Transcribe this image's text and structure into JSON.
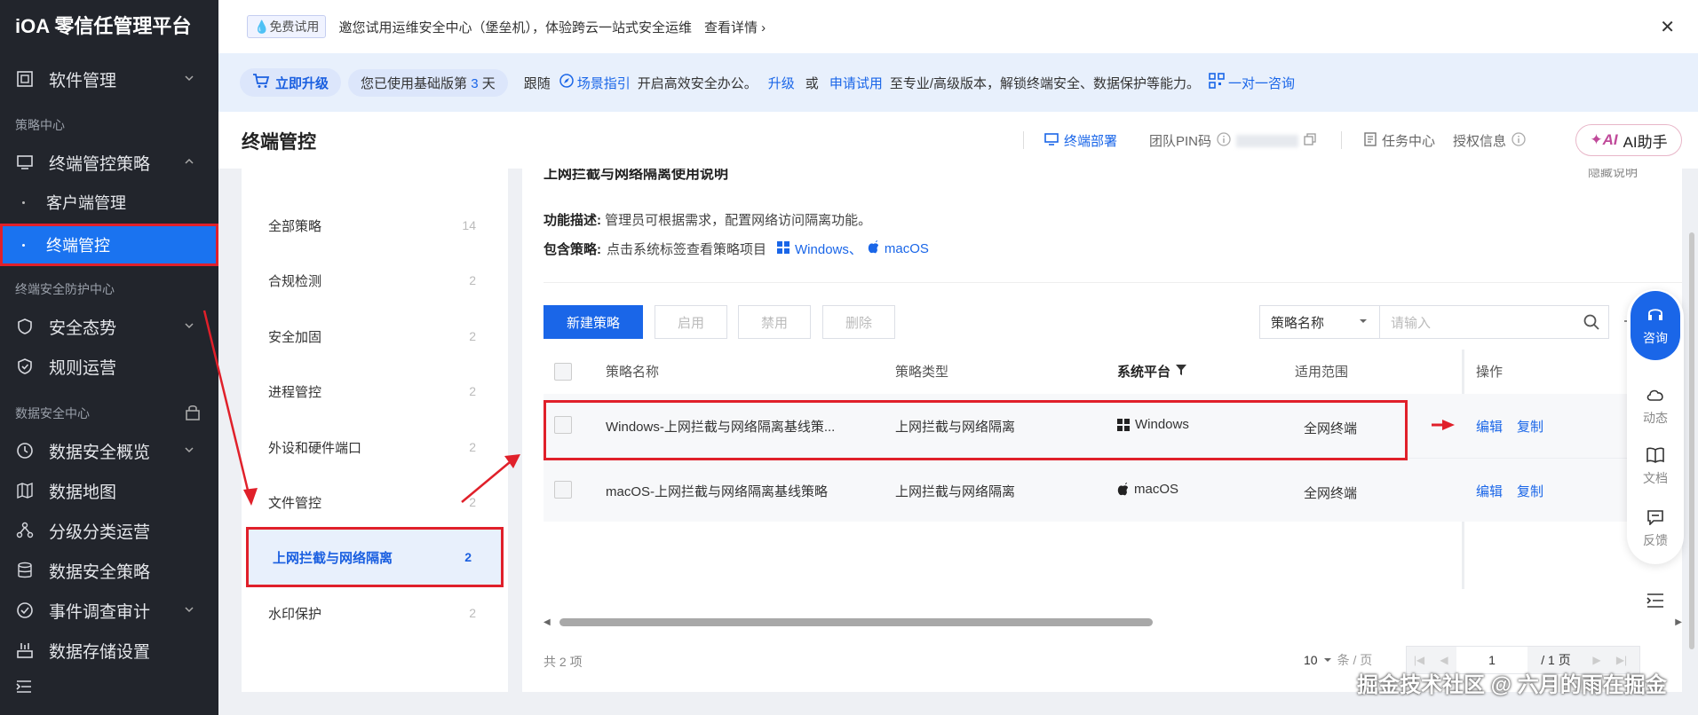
{
  "brand": "iOA 零信任管理平台",
  "sidebar": {
    "software": "软件管理",
    "sec_policy": "策略中心",
    "terminal_policy": "终端管控策略",
    "client_mgmt": "客户端管理",
    "terminal_control": "终端管控",
    "sec_protect": "终端安全防护中心",
    "security_posture": "安全态势",
    "rule_ops": "规则运营",
    "sec_data": "数据安全中心",
    "data_overview": "数据安全概览",
    "data_map": "数据地图",
    "classify": "分级分类运营",
    "data_policy": "数据安全策略",
    "event_audit": "事件调查审计",
    "data_storage": "数据存储设置"
  },
  "notice": {
    "tag": "免费试用",
    "text": "邀您试用运维安全中心（堡垒机），体验跨云一站式安全运维",
    "detail": "查看详情"
  },
  "upgrade": {
    "button": "立即升级",
    "days_prefix": "您已使用基础版第",
    "days": "3",
    "days_suffix": "天",
    "follow": "跟随",
    "guide": "场景指引",
    "start": "开启高效安全办公。",
    "up": "升级",
    "or": "或",
    "apply": "申请试用",
    "rest": "至专业/高级版本，解锁终端安全、数据保护等能力。",
    "consult": "一对一咨询"
  },
  "header": {
    "title": "终端管控",
    "deploy": "终端部署",
    "pin": "团队PIN码",
    "tasks": "任务中心",
    "license": "授权信息",
    "ai": "AI助手"
  },
  "categories": [
    {
      "label": "全部策略",
      "count": "14"
    },
    {
      "label": "合规检测",
      "count": "2"
    },
    {
      "label": "安全加固",
      "count": "2"
    },
    {
      "label": "进程管控",
      "count": "2"
    },
    {
      "label": "外设和硬件端口",
      "count": "2"
    },
    {
      "label": "文件管控",
      "count": "2"
    },
    {
      "label": "上网拦截与网络隔离",
      "count": "2"
    },
    {
      "label": "水印保护",
      "count": "2"
    }
  ],
  "main": {
    "section_title": "上网拦截与网络隔离使用说明",
    "hide": "隐藏说明",
    "func_label": "功能描述:",
    "func_text": "管理员可根据需求，配置网络访问隔离功能。",
    "incl_label": "包含策略:",
    "incl_text": "点击系统标签查看策略项目",
    "tag_windows": "Windows、",
    "tag_macos": "macOS",
    "btn_new": "新建策略",
    "btn_enable": "启用",
    "btn_disable": "禁用",
    "btn_delete": "删除",
    "select": "策略名称",
    "search_placeholder": "请输入",
    "columns": [
      "策略名称",
      "策略类型",
      "系统平台",
      "适用范围",
      "操作"
    ],
    "rows": [
      {
        "name": "Windows-上网拦截与网络隔离基线策...",
        "type": "上网拦截与网络隔离",
        "platform": "Windows",
        "scope": "全网终端",
        "edit": "编辑",
        "copy": "复制"
      },
      {
        "name": "macOS-上网拦截与网络隔离基线策略",
        "type": "上网拦截与网络隔离",
        "platform": "macOS",
        "scope": "全网终端",
        "edit": "编辑",
        "copy": "复制"
      }
    ],
    "total": "共 2 项",
    "page_size": "10",
    "per_page": "条 / 页",
    "page": "1",
    "pages": "/ 1 页"
  },
  "float": {
    "consult": "咨询",
    "dynamic": "动态",
    "docs": "文档",
    "feedback": "反馈"
  },
  "watermark": "掘金技术社区 @ 六月的雨在掘金",
  "colors": {
    "primary": "#1a66e8",
    "sidebar_bg": "#22252c",
    "highlight": "#e0202a"
  }
}
